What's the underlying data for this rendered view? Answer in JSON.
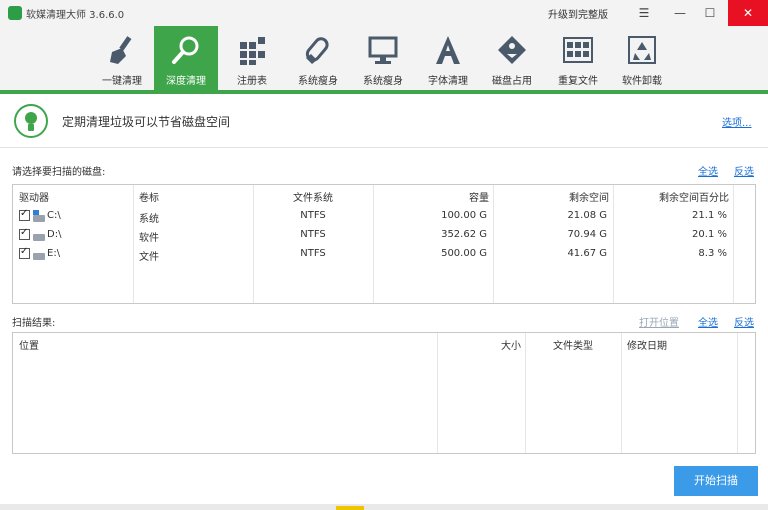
{
  "titlebar": {
    "title": "软媒清理大师 3.6.6.0",
    "upgrade_label": "升级到完整版",
    "menu_glyph": "☰",
    "minimize_glyph": "—",
    "maximize_glyph": "☐",
    "close_glyph": "✕"
  },
  "toolbar": {
    "items": [
      {
        "label": "一键清理",
        "icon": "broom-icon"
      },
      {
        "label": "深度清理",
        "icon": "magnifier-icon",
        "active": true
      },
      {
        "label": "注册表",
        "icon": "registry-icon"
      },
      {
        "label": "系统瘦身",
        "icon": "eraser-icon"
      },
      {
        "label": "系统瘦身",
        "icon": "monitor-icon"
      },
      {
        "label": "字体清理",
        "icon": "font-icon"
      },
      {
        "label": "磁盘占用",
        "icon": "disk-tag-icon"
      },
      {
        "label": "重复文件",
        "icon": "duplicate-grid-icon"
      },
      {
        "label": "软件卸载",
        "icon": "recycle-icon"
      }
    ],
    "accent_color": "#3ea54a"
  },
  "banner": {
    "text": "定期清理垃圾可以节省磁盘空间",
    "options_label": "选项..."
  },
  "disks": {
    "section_label": "请选择要扫描的磁盘:",
    "select_all": "全选",
    "invert": "反选",
    "columns": [
      "驱动器",
      "卷标",
      "文件系统",
      "容量",
      "剩余空间",
      "剩余空间百分比"
    ],
    "rows": [
      {
        "drive": "C:\\",
        "label": "系统",
        "fs": "NTFS",
        "capacity": "100.00 G",
        "free": "21.08 G",
        "percent": "21.1 %",
        "checked": true
      },
      {
        "drive": "D:\\",
        "label": "软件",
        "fs": "NTFS",
        "capacity": "352.62 G",
        "free": "70.94 G",
        "percent": "20.1 %",
        "checked": true
      },
      {
        "drive": "E:\\",
        "label": "文件",
        "fs": "NTFS",
        "capacity": "500.00 G",
        "free": "41.67 G",
        "percent": "8.3 %",
        "checked": true
      }
    ]
  },
  "results": {
    "section_label": "扫描结果:",
    "open_location": "打开位置",
    "select_all": "全选",
    "invert": "反选",
    "columns": [
      "位置",
      "大小",
      "文件类型",
      "修改日期"
    ]
  },
  "scan_button": "开始扫描",
  "colors": {
    "accent": "#3ea54a",
    "link": "#1a6fd6",
    "button": "#3b9be8",
    "close": "#e81123"
  }
}
